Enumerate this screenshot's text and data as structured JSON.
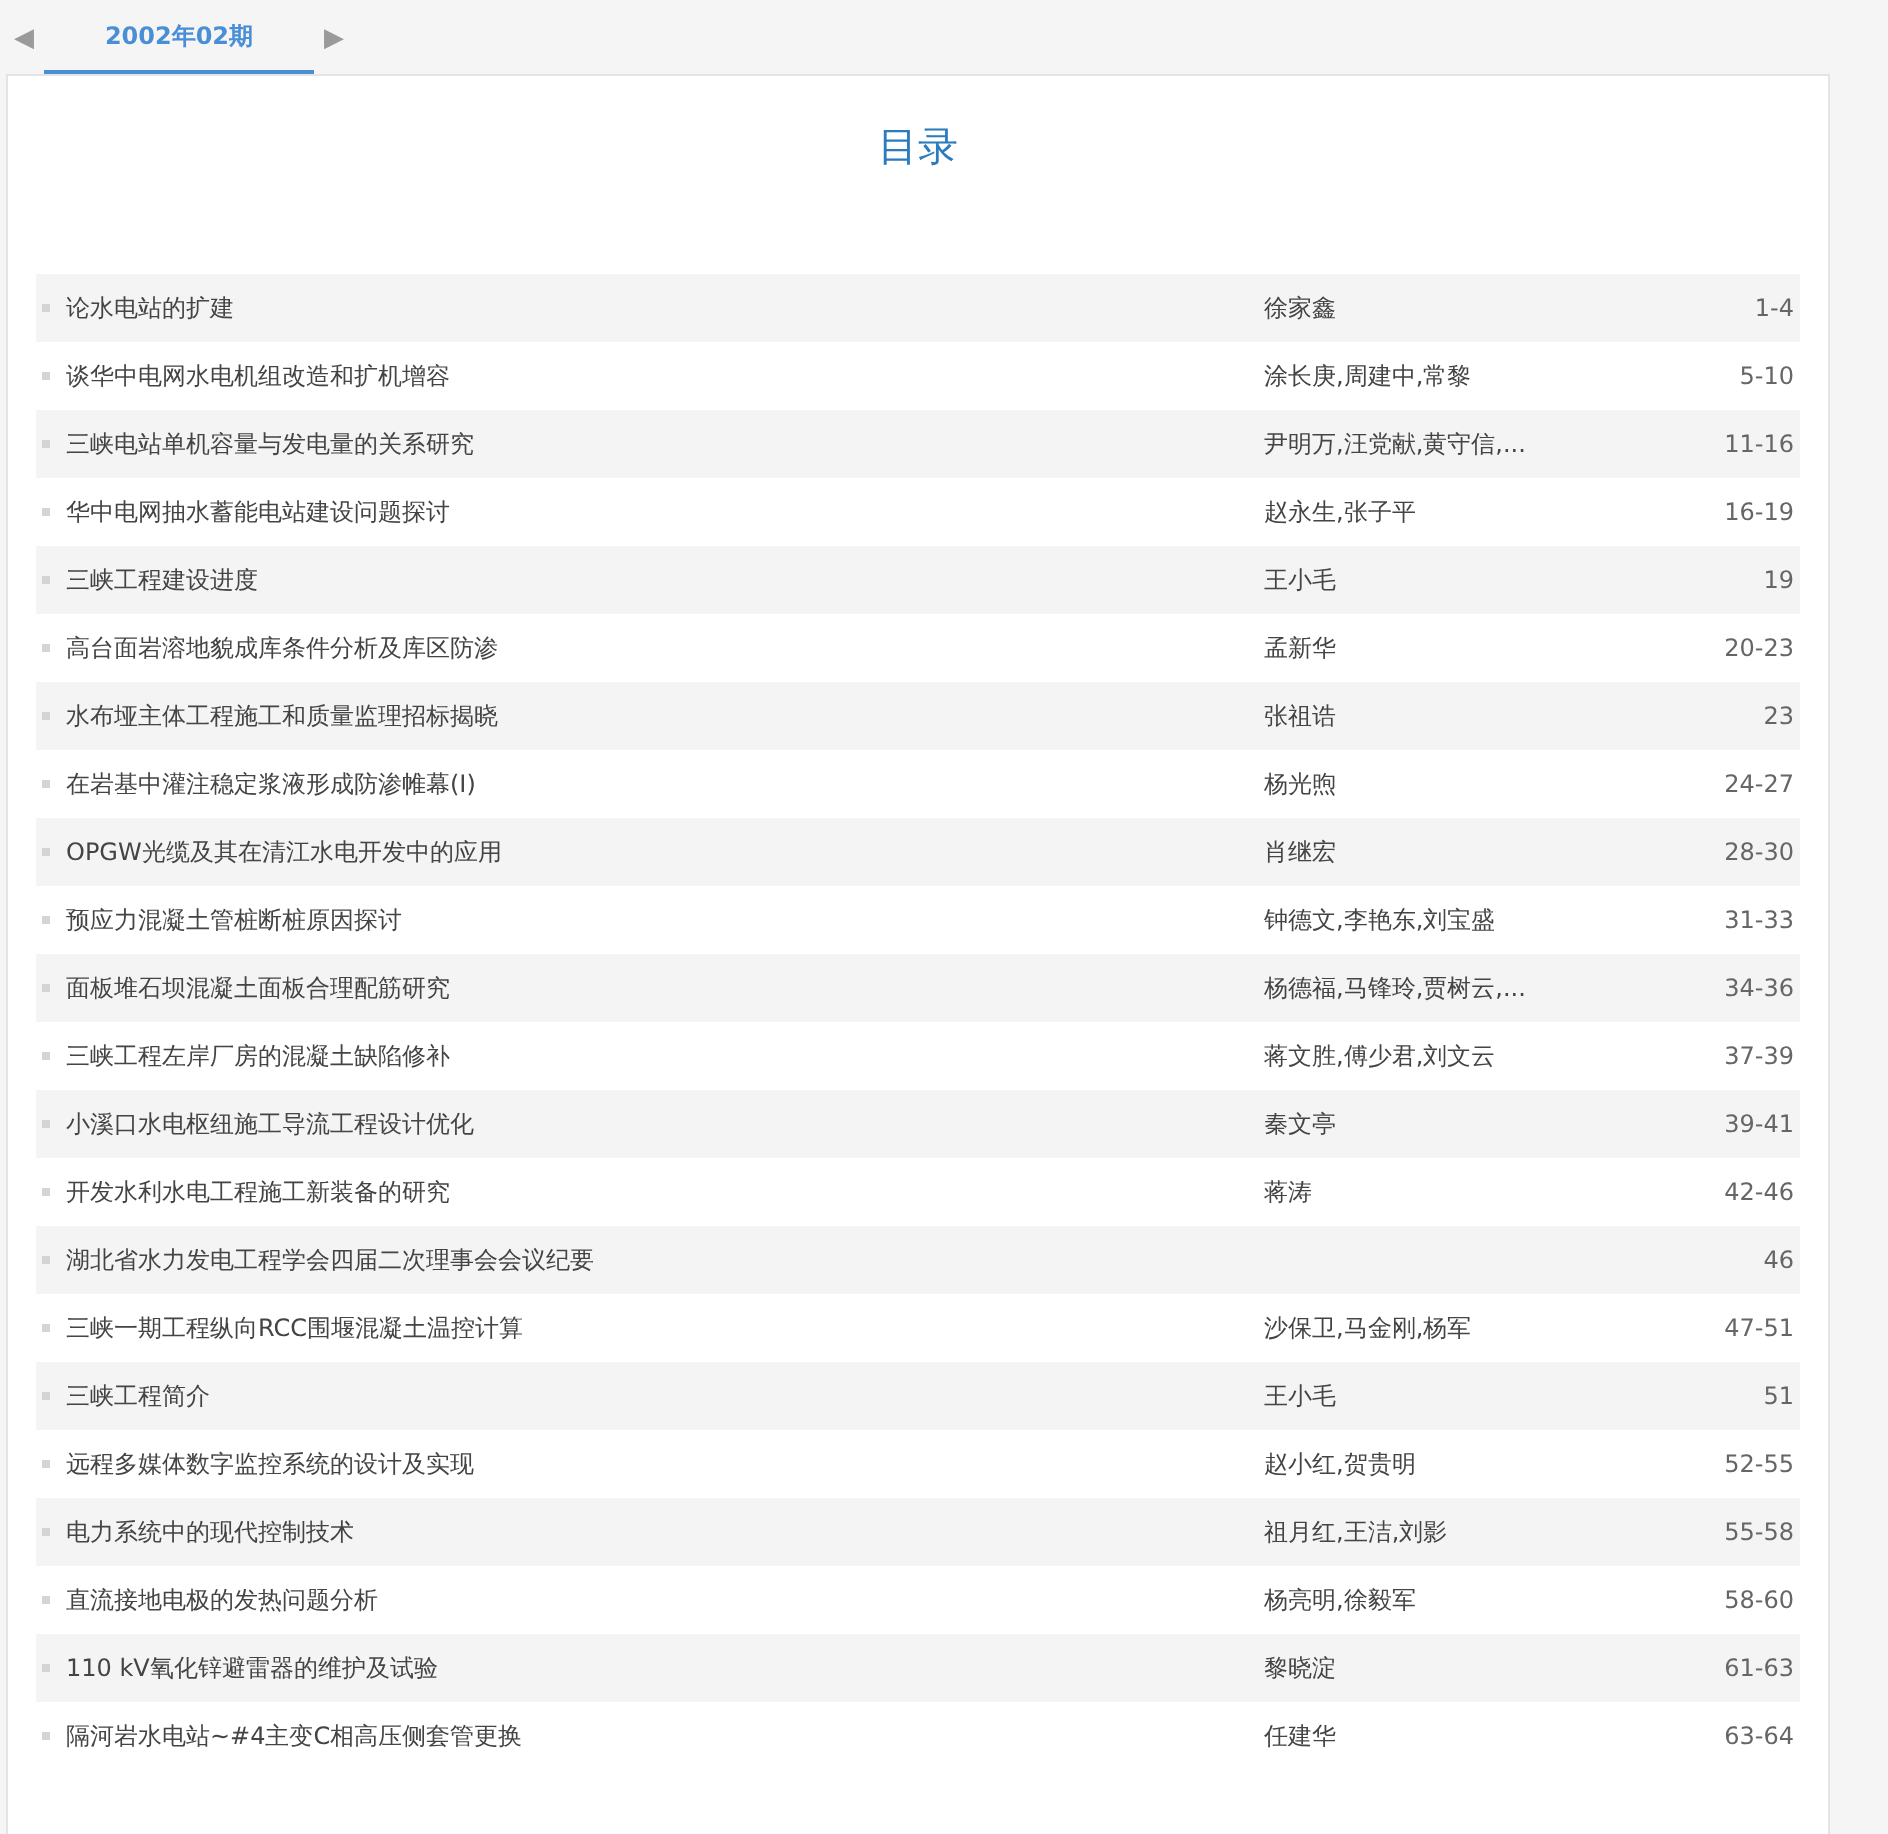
{
  "issue_tabs": {
    "prev_arrow": "◀",
    "next_arrow": "▶",
    "tabs": [
      {
        "label": "2002年02期",
        "selected": true
      }
    ]
  },
  "contents": {
    "title": "目录",
    "rows": [
      {
        "title": "论水电站的扩建",
        "authors": "徐家鑫",
        "pages": "1-4"
      },
      {
        "title": "谈华中电网水电机组改造和扩机增容",
        "authors": "涂长庚,周建中,常黎",
        "pages": "5-10"
      },
      {
        "title": "三峡电站单机容量与发电量的关系研究",
        "authors": "尹明万,汪党献,黄守信,...",
        "pages": "11-16"
      },
      {
        "title": "华中电网抽水蓄能电站建设问题探讨",
        "authors": "赵永生,张子平",
        "pages": "16-19"
      },
      {
        "title": "三峡工程建设进度",
        "authors": "王小毛",
        "pages": "19"
      },
      {
        "title": "高台面岩溶地貌成库条件分析及库区防渗",
        "authors": "孟新华",
        "pages": "20-23"
      },
      {
        "title": "水布垭主体工程施工和质量监理招标揭晓",
        "authors": "张祖诰",
        "pages": "23"
      },
      {
        "title": "在岩基中灌注稳定浆液形成防渗帷幕(Ⅰ)",
        "authors": "杨光煦",
        "pages": "24-27"
      },
      {
        "title": "OPGW光缆及其在清江水电开发中的应用",
        "authors": "肖继宏",
        "pages": "28-30"
      },
      {
        "title": "预应力混凝土管桩断桩原因探讨",
        "authors": "钟德文,李艳东,刘宝盛",
        "pages": "31-33"
      },
      {
        "title": "面板堆石坝混凝土面板合理配筋研究",
        "authors": "杨德福,马锋玲,贾树云,...",
        "pages": "34-36"
      },
      {
        "title": "三峡工程左岸厂房的混凝土缺陷修补",
        "authors": "蒋文胜,傅少君,刘文云",
        "pages": "37-39"
      },
      {
        "title": "小溪口水电枢纽施工导流工程设计优化",
        "authors": "秦文亭",
        "pages": "39-41"
      },
      {
        "title": "开发水利水电工程施工新装备的研究",
        "authors": "蒋涛",
        "pages": "42-46"
      },
      {
        "title": "湖北省水力发电工程学会四届二次理事会会议纪要",
        "pages": "46"
      },
      {
        "title": "三峡一期工程纵向RCC围堰混凝土温控计算",
        "authors": "沙保卫,马金刚,杨军",
        "pages": "47-51"
      },
      {
        "title": "三峡工程简介",
        "authors": "王小毛",
        "pages": "51"
      },
      {
        "title": "远程多媒体数字监控系统的设计及实现",
        "authors": "赵小红,贺贵明",
        "pages": "52-55"
      },
      {
        "title": "电力系统中的现代控制技术",
        "authors": "祖月红,王洁,刘影",
        "pages": "55-58"
      },
      {
        "title": "直流接地电极的发热问题分析",
        "authors": "杨亮明,徐毅军",
        "pages": "58-60"
      },
      {
        "title": "110 kV氧化锌避雷器的维护及试验",
        "authors": "黎晓淀",
        "pages": "61-63"
      },
      {
        "title": "隔河岩水电站~#4主变C相高压侧套管更换",
        "authors": "任建华",
        "pages": "63-64"
      }
    ]
  }
}
